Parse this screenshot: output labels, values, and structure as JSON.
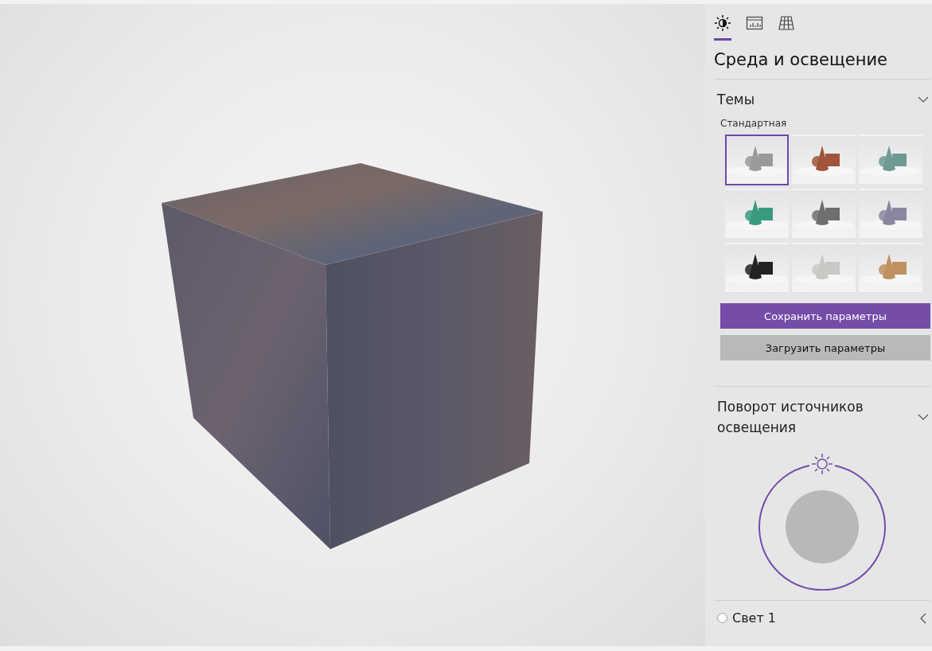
{
  "tabs": [
    {
      "kind": "sun",
      "selected": true
    },
    {
      "kind": "chart",
      "selected": false
    },
    {
      "kind": "grid",
      "selected": false
    }
  ],
  "panel_title": "Среда и освещение",
  "themes": {
    "title": "Темы",
    "expanded": true,
    "group_label": "Стандартная",
    "items": [
      {
        "color": "#9a9a9a",
        "selected": true
      },
      {
        "color": "#a0553a",
        "selected": false
      },
      {
        "color": "#6f9a94",
        "selected": false
      },
      {
        "color": "#3a9a80",
        "selected": false
      },
      {
        "color": "#6e6e6e",
        "selected": false
      },
      {
        "color": "#8a86a0",
        "selected": false
      },
      {
        "color": "#222222",
        "selected": false
      },
      {
        "color": "#c8c8c4",
        "selected": false
      },
      {
        "color": "#c09060",
        "selected": false
      }
    ],
    "buttons": [
      {
        "label": "Сохранить параметры",
        "kind": "primary"
      },
      {
        "label": "Загрузить параметры",
        "kind": "secondary"
      }
    ]
  },
  "light_rotation": {
    "title": "Поворот источников освещения",
    "expanded": true
  },
  "lights": [
    {
      "label": "Свет 1",
      "selected": false,
      "expanded": false
    }
  ]
}
